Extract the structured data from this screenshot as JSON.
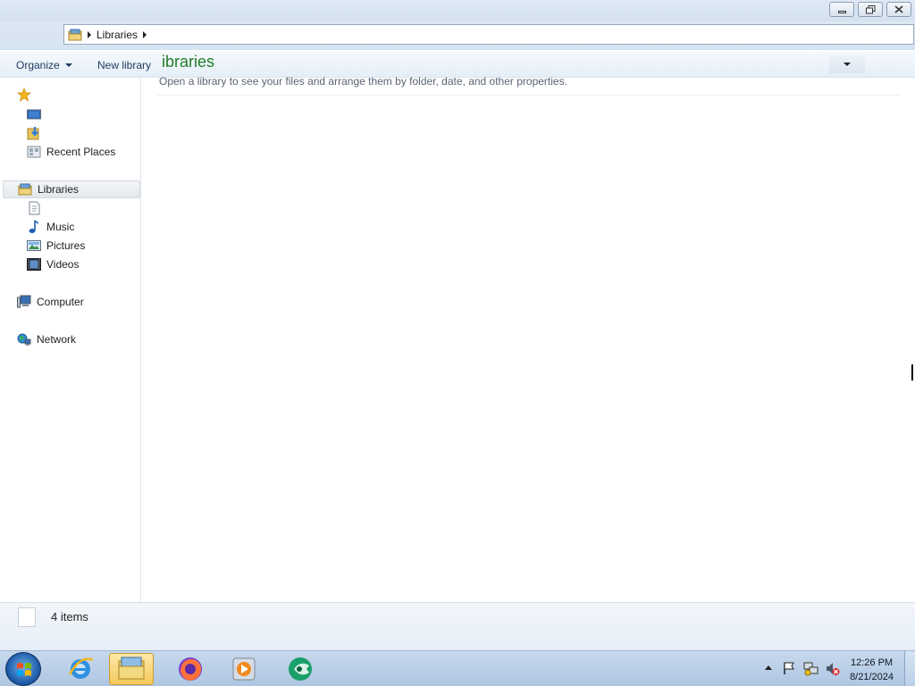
{
  "address": {
    "segments": [
      "Libraries"
    ]
  },
  "toolbar": {
    "organize_label": "Organize",
    "new_library_label": "New library"
  },
  "nav": {
    "favorites": [
      {
        "name": "favorites-star",
        "label": ""
      },
      {
        "name": "desktop",
        "label": ""
      },
      {
        "name": "downloads",
        "label": ""
      },
      {
        "name": "recent-places",
        "label": "Recent Places"
      }
    ],
    "libraries": {
      "label": "Libraries"
    },
    "library_items": [
      {
        "name": "documents",
        "label": ""
      },
      {
        "name": "music",
        "label": "Music"
      },
      {
        "name": "pictures",
        "label": "Pictures"
      },
      {
        "name": "videos",
        "label": "Videos"
      }
    ],
    "computer": {
      "label": "Computer"
    },
    "network": {
      "label": "Network"
    }
  },
  "content": {
    "title": "ibraries",
    "description": "Open a library to see your files and arrange them by folder, date, and other properties."
  },
  "status": {
    "count": "4 items"
  },
  "taskbar": {
    "items": [
      "start-button",
      "internet-explorer-icon",
      "windows-explorer-icon",
      "firefox-icon",
      "media-player-icon",
      "app-icon"
    ]
  },
  "clock": {
    "time": "12:26 PM",
    "date": "8/21/2024"
  },
  "colors": {
    "accent_title": "#1e7d26",
    "taskbar": "#aec6e3"
  }
}
